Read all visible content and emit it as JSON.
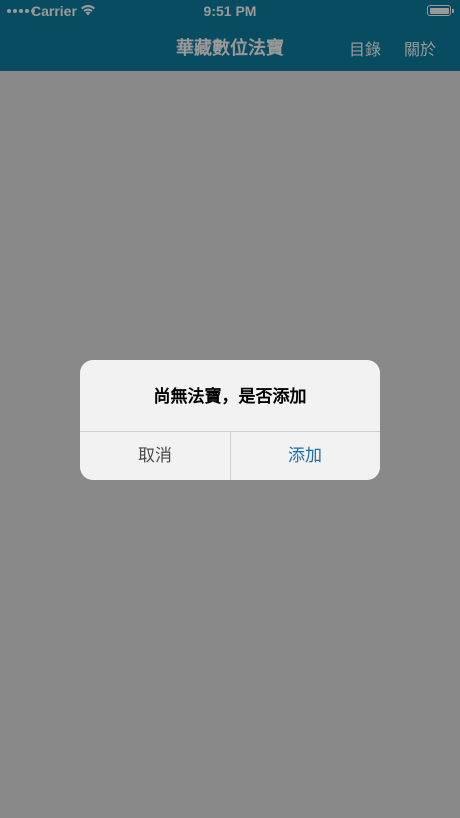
{
  "status_bar": {
    "carrier": "Carrier",
    "time": "9:51 PM"
  },
  "nav": {
    "title": "華藏數位法寶",
    "catalog_label": "目錄",
    "about_label": "關於"
  },
  "alert": {
    "message": "尚無法寶，是否添加",
    "cancel_label": "取消",
    "add_label": "添加"
  },
  "colors": {
    "nav_background": "#0d7fa2",
    "alert_action": "#1a6fb0"
  }
}
